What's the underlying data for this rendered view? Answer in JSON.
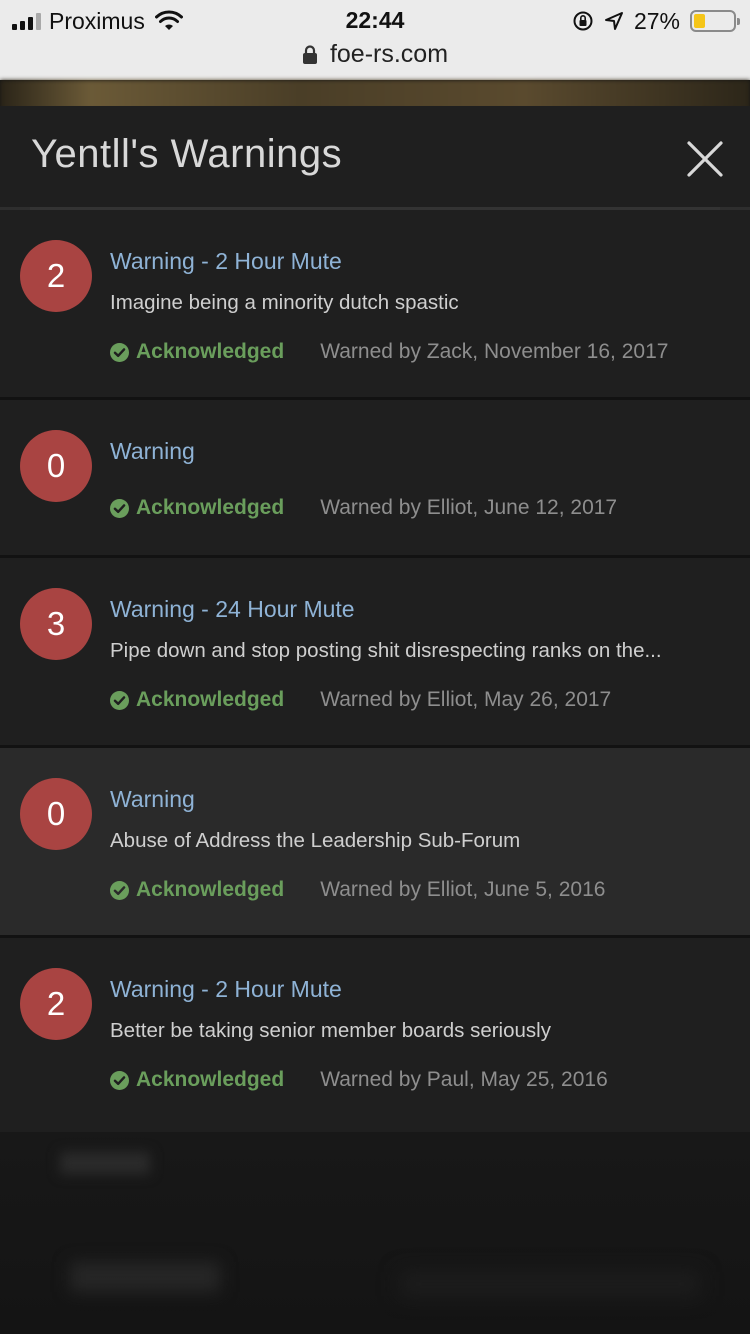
{
  "status_bar": {
    "carrier": "Proximus",
    "time": "22:44",
    "battery_percent": "27%",
    "battery_level": 0.27,
    "url": "foe-rs.com"
  },
  "modal": {
    "title": "Yentll's Warnings",
    "close_icon": "close-icon"
  },
  "warnings": [
    {
      "points": "2",
      "title": "Warning - 2 Hour Mute",
      "reason": "Imagine being a minority dutch spastic",
      "status": "Acknowledged",
      "warned": "Warned by Zack, November 16, 2017"
    },
    {
      "points": "0",
      "title": "Warning",
      "reason": "",
      "status": "Acknowledged",
      "warned": "Warned by Elliot, June 12, 2017"
    },
    {
      "points": "3",
      "title": "Warning - 24 Hour Mute",
      "reason": "Pipe down and stop posting shit disrespecting ranks on the...",
      "status": "Acknowledged",
      "warned": "Warned by Elliot, May 26, 2017"
    },
    {
      "points": "0",
      "title": "Warning",
      "reason": "Abuse of Address the Leadership Sub-Forum",
      "status": "Acknowledged",
      "warned": "Warned by Elliot, June 5, 2016"
    },
    {
      "points": "2",
      "title": "Warning - 2 Hour Mute",
      "reason": "Better be taking senior member boards seriously",
      "status": "Acknowledged",
      "warned": "Warned by Paul, May 25, 2016"
    }
  ],
  "colors": {
    "points_badge": "#a94442",
    "title_link": "#8fb3d6",
    "acknowledged": "#6a9e5c"
  }
}
